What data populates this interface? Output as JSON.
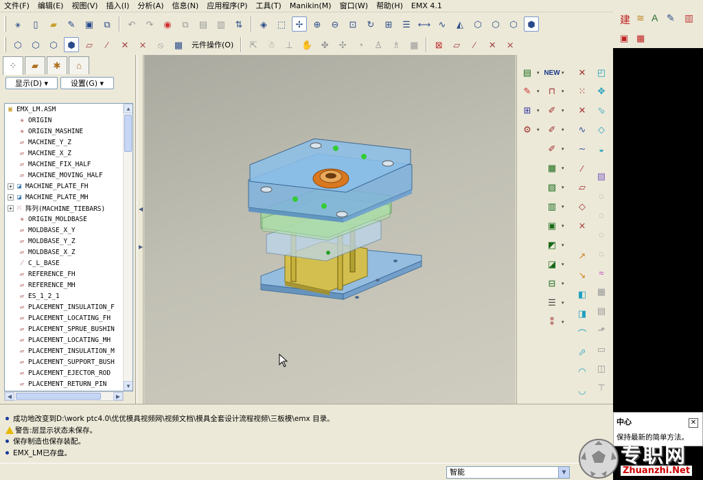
{
  "menubar": {
    "items": [
      "文件(F)",
      "编辑(E)",
      "视图(V)",
      "插入(I)",
      "分析(A)",
      "信息(N)",
      "应用程序(P)",
      "工具(T)",
      "Manikin(M)",
      "窗口(W)",
      "帮助(H)",
      "EMX 4.1"
    ]
  },
  "toolbar2": {
    "component_ops_label": "元件操作(O)"
  },
  "left_panel": {
    "show_label": "显示(D)",
    "settings_label": "设置(G)",
    "tree": [
      {
        "label": "EMX_LM.ASM",
        "icon": "assembly-icon",
        "expandable": false,
        "indent": 0
      },
      {
        "label": "ORIGIN",
        "icon": "csys-icon",
        "expandable": false,
        "indent": 1
      },
      {
        "label": "ORIGIN_MASHINE",
        "icon": "csys-icon",
        "expandable": false,
        "indent": 1
      },
      {
        "label": "MACHINE_Y_Z",
        "icon": "datum-plane-icon",
        "expandable": false,
        "indent": 1
      },
      {
        "label": "MACHINE_X_Z",
        "icon": "datum-plane-icon",
        "expandable": false,
        "indent": 1
      },
      {
        "label": "MACHINE_FIX_HALF",
        "icon": "datum-plane-icon",
        "expandable": false,
        "indent": 1
      },
      {
        "label": "MACHINE_MOVING_HALF",
        "icon": "datum-plane-icon",
        "expandable": false,
        "indent": 1
      },
      {
        "label": "MACHINE_PLATE_FH",
        "icon": "part-icon",
        "expandable": true,
        "indent": 1
      },
      {
        "label": "MACHINE_PLATE_MH",
        "icon": "part-icon",
        "expandable": true,
        "indent": 1
      },
      {
        "label": "阵列(MACHINE_TIEBARS)",
        "icon": "pattern-icon",
        "expandable": true,
        "indent": 1
      },
      {
        "label": "ORIGIN_MOLDBASE",
        "icon": "csys-icon",
        "expandable": false,
        "indent": 1
      },
      {
        "label": "MOLDBASE_X_Y",
        "icon": "datum-plane-icon",
        "expandable": false,
        "indent": 1
      },
      {
        "label": "MOLDBASE_Y_Z",
        "icon": "datum-plane-icon",
        "expandable": false,
        "indent": 1
      },
      {
        "label": "MOLDBASE_X_Z",
        "icon": "datum-plane-icon",
        "expandable": false,
        "indent": 1
      },
      {
        "label": "C_L_BASE",
        "icon": "datum-axis-icon",
        "expandable": false,
        "indent": 1
      },
      {
        "label": "REFERENCE_FH",
        "icon": "datum-plane-icon",
        "expandable": false,
        "indent": 1
      },
      {
        "label": "REFERENCE_MH",
        "icon": "datum-plane-icon",
        "expandable": false,
        "indent": 1
      },
      {
        "label": "ES_1_2_1",
        "icon": "datum-plane-icon",
        "expandable": false,
        "indent": 1
      },
      {
        "label": "PLACEMENT_INSULATION_F",
        "icon": "datum-plane-icon",
        "expandable": false,
        "indent": 1
      },
      {
        "label": "PLACEMENT_LOCATING_FH",
        "icon": "datum-plane-icon",
        "expandable": false,
        "indent": 1
      },
      {
        "label": "PLACEMENT_SPRUE_BUSHIN",
        "icon": "datum-plane-icon",
        "expandable": false,
        "indent": 1
      },
      {
        "label": "PLACEMENT_LOCATING_MH",
        "icon": "datum-plane-icon",
        "expandable": false,
        "indent": 1
      },
      {
        "label": "PLACEMENT_INSULATION_M",
        "icon": "datum-plane-icon",
        "expandable": false,
        "indent": 1
      },
      {
        "label": "PLACEMENT_SUPPORT_BUSH",
        "icon": "datum-plane-icon",
        "expandable": false,
        "indent": 1
      },
      {
        "label": "PLACEMENT_EJECTOR_ROD",
        "icon": "datum-plane-icon",
        "expandable": false,
        "indent": 1
      },
      {
        "label": "PLACEMENT_RETURN_PIN",
        "icon": "datum-plane-icon",
        "expandable": false,
        "indent": 1
      }
    ]
  },
  "messages": {
    "line1": "成功地改变到D:\\work ptc4.0\\优优模具视频网\\视频文档\\模具全套设计流程视频\\三板模\\emx 目录。",
    "line2": "警告:层显示状态未保存。",
    "line3": "保存制造也保存装配。",
    "line4": "EMX_LM已存盘。"
  },
  "status": {
    "filter_value": "智能"
  },
  "tip": {
    "title": "中心",
    "text": "保持最新的简单方法。"
  },
  "outer_toolbar": {
    "build_label": "建"
  },
  "watermark": {
    "main": "专职网",
    "sub": "Zhuanzhi.Net"
  },
  "colors": {
    "plate_blue": "#7fb3e0",
    "plate_yellow": "#d9c043",
    "pin_green": "#33cc33",
    "sprue_orange": "#d9781f"
  }
}
